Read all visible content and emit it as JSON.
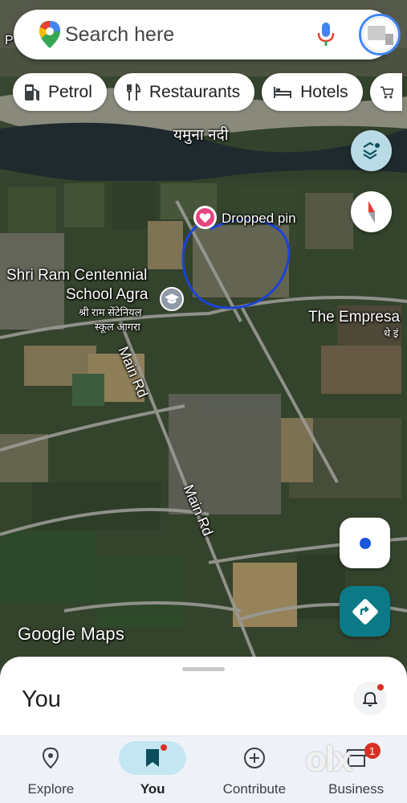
{
  "search": {
    "placeholder": "Search here"
  },
  "chips": [
    "Petrol",
    "Restaurants",
    "Hotels"
  ],
  "map": {
    "labels": {
      "partial_top_left": "P",
      "partial_top_left2": "",
      "river": "यमुना नदी",
      "dropped_pin": "Dropped pin",
      "school_line1": "Shri Ram Centennial",
      "school_line2": "School Agra",
      "school_hindi1": "श्री राम सेंटेनियल",
      "school_hindi2": "स्कूल आगरा",
      "place_east": "The Empresa",
      "place_east_hindi": "थे इं",
      "road1": "Main Rd",
      "road2": "Main Rd"
    },
    "watermark": "Google Maps"
  },
  "sheet": {
    "title": "You"
  },
  "nav": {
    "items": [
      {
        "label": "Explore",
        "icon": "location-pin-icon",
        "active": false
      },
      {
        "label": "You",
        "icon": "bookmark-icon",
        "active": true
      },
      {
        "label": "Contribute",
        "icon": "add-circle-icon",
        "active": false
      },
      {
        "label": "Business",
        "icon": "storefront-icon",
        "active": false,
        "badge": "1"
      }
    ]
  },
  "overlay": {
    "olx_watermark": "olx"
  },
  "colors": {
    "accent_teal": "#0b7a86",
    "active_nav_pill": "#c3e6f2",
    "dropped_pin": "#e8437f",
    "notification_red": "#d93025",
    "location_dot": "#1a56db"
  }
}
